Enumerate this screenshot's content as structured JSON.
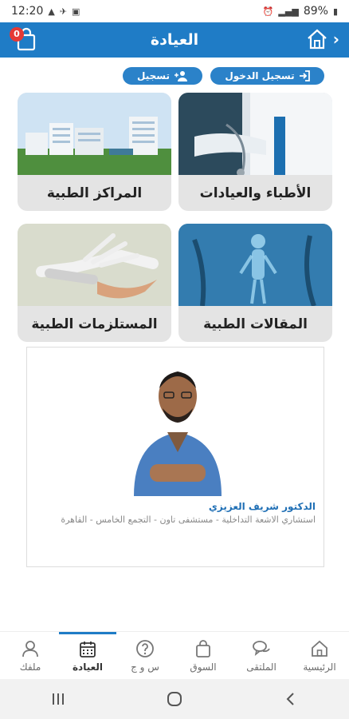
{
  "status_bar": {
    "time": "12:20",
    "battery": "89%"
  },
  "header": {
    "title": "العيادة",
    "cart_count": "0"
  },
  "auth": {
    "login_label": "تسجيل الدخول",
    "register_label": "تسجيل"
  },
  "categories": [
    {
      "label": "الأطباء والعيادات",
      "image": "doctors-photo"
    },
    {
      "label": "المراكز الطبية",
      "image": "hospital-buildings-photo"
    },
    {
      "label": "المقالات الطبية",
      "image": "medical-xray-photo"
    },
    {
      "label": "المستلزمات الطبية",
      "image": "prosthetic-hand-photo"
    }
  ],
  "featured": {
    "name": "الدكتور شريف العزيزي",
    "description": "استشاري الاشعة التداخلية - مستشفى تاون - التجمع الخامس - القاهرة"
  },
  "bottom_nav": {
    "home": "الرئيسية",
    "forum": "الملتقى",
    "market": "السوق",
    "faq": "س و ج",
    "clinic": "العيادة",
    "profile": "ملفك"
  },
  "colors": {
    "brand": "#1f7cc6",
    "badge": "#e53935",
    "card_bg": "#e4e4e4"
  }
}
